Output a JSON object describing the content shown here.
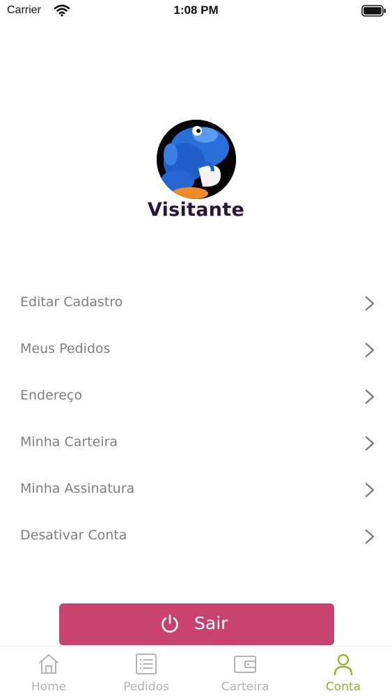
{
  "status_bar": {
    "carrier": "Carrier",
    "time": "1:08 PM"
  },
  "profile": {
    "name": "Visitante"
  },
  "menu": {
    "items": [
      {
        "label": "Editar Cadastro"
      },
      {
        "label": "Meus Pedidos"
      },
      {
        "label": "Endereço"
      },
      {
        "label": "Minha Carteira"
      },
      {
        "label": "Minha Assinatura"
      },
      {
        "label": "Desativar Conta"
      }
    ]
  },
  "logout": {
    "label": "Sair",
    "color": "#c8426f"
  },
  "tab_bar": {
    "active": "Conta",
    "active_color": "#8db52b",
    "tabs": [
      {
        "label": "Home",
        "icon": "home-icon"
      },
      {
        "label": "Pedidos",
        "icon": "list-icon"
      },
      {
        "label": "Carteira",
        "icon": "wallet-icon"
      },
      {
        "label": "Conta",
        "icon": "user-icon"
      }
    ]
  }
}
